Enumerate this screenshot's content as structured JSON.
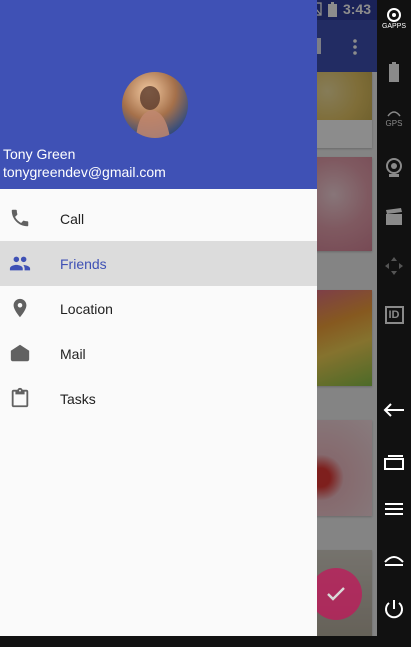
{
  "status_bar": {
    "time": "3:43"
  },
  "user": {
    "name": "Tony Green",
    "email": "tonygreendev@gmail.com"
  },
  "nav": {
    "items": [
      {
        "label": "Call",
        "icon": "phone-icon",
        "active": false
      },
      {
        "label": "Friends",
        "icon": "people-icon",
        "active": true
      },
      {
        "label": "Location",
        "icon": "location-pin-icon",
        "active": false
      },
      {
        "label": "Mail",
        "icon": "mail-open-icon",
        "active": false
      },
      {
        "label": "Tasks",
        "icon": "clipboard-icon",
        "active": false
      }
    ]
  },
  "emulator_panel": {
    "gapps_label": "GAPPS",
    "gps_label": "GPS",
    "id_label": "ID"
  },
  "colors": {
    "primary": "#3f51b5",
    "primary_dark": "#303f9f",
    "accent": "#c2185b",
    "active_bg": "#dcdcdc"
  }
}
